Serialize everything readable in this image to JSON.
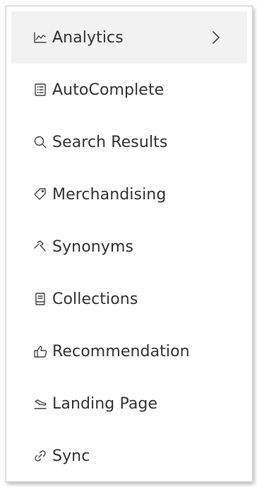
{
  "menu": {
    "items": [
      {
        "label": "Analytics",
        "icon": "line-chart-icon",
        "active": true,
        "has_submenu": true
      },
      {
        "label": "AutoComplete",
        "icon": "list-document-icon",
        "active": false
      },
      {
        "label": "Search Results",
        "icon": "search-icon",
        "active": false
      },
      {
        "label": "Merchandising",
        "icon": "tag-icon",
        "active": false
      },
      {
        "label": "Synonyms",
        "icon": "hammer-icon",
        "active": false
      },
      {
        "label": "Collections",
        "icon": "document-icon",
        "active": false
      },
      {
        "label": "Recommendation",
        "icon": "thumbs-up-icon",
        "active": false
      },
      {
        "label": "Landing Page",
        "icon": "landing-icon",
        "active": false
      },
      {
        "label": "Sync",
        "icon": "link-icon",
        "active": false
      }
    ]
  },
  "colors": {
    "active_background": "#f2f2f2",
    "text": "#333333",
    "icon": "#444444"
  }
}
